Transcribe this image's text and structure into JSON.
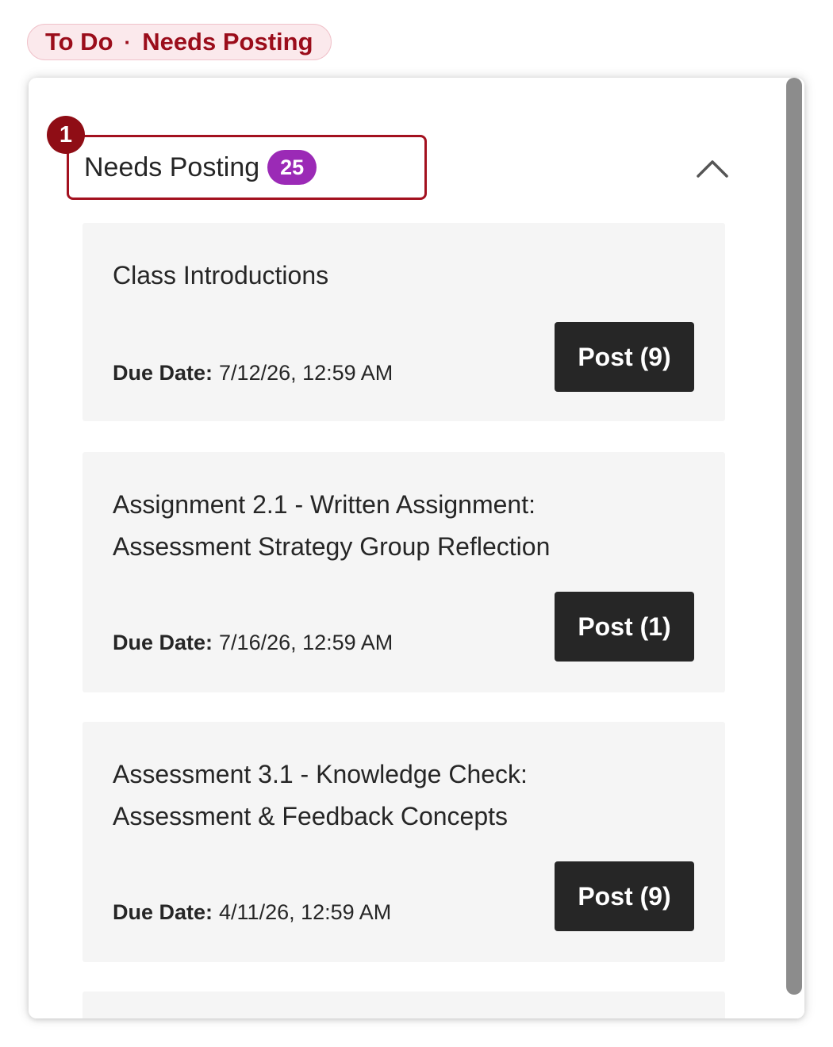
{
  "breadcrumb": {
    "first": "To Do",
    "separator": "·",
    "second": "Needs Posting"
  },
  "callout": {
    "number": "1"
  },
  "section": {
    "title": "Needs Posting",
    "count": "25",
    "collapse_icon": "chevron-up-icon"
  },
  "items": [
    {
      "title": "Class Introductions",
      "due_label": "Due Date:",
      "due_value": "7/12/26, 12:59 AM",
      "button_label": "Post (9)"
    },
    {
      "title": "Assignment 2.1 - Written Assignment: Assessment Strategy Group Reflection",
      "due_label": "Due Date:",
      "due_value": "7/16/26, 12:59 AM",
      "button_label": "Post (1)"
    },
    {
      "title": "Assessment 3.1 - Knowledge Check: Assessment & Feedback Concepts",
      "due_label": "Due Date:",
      "due_value": "4/11/26, 12:59 AM",
      "button_label": "Post (9)"
    }
  ],
  "colors": {
    "accent_red": "#a3111f",
    "count_badge": "#9b2ab6",
    "button_dark": "#262626",
    "card_bg": "#f5f5f5"
  }
}
